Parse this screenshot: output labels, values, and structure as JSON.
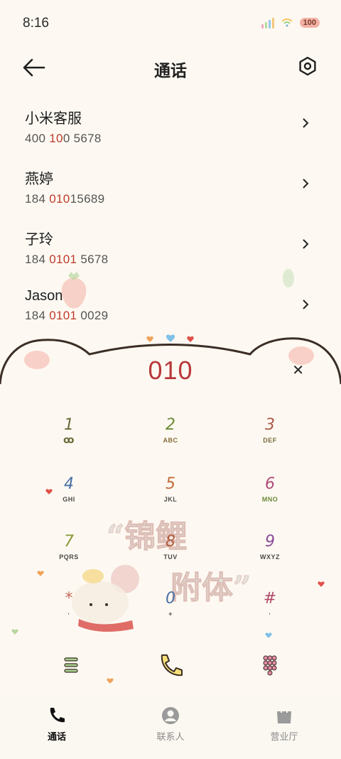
{
  "status_bar": {
    "time": "8:16",
    "battery": "100"
  },
  "header": {
    "title": "通话",
    "back_icon": "arrow-left-icon",
    "settings_icon": "settings-hexagon-icon"
  },
  "contacts": [
    {
      "name": "小米客服",
      "number_parts": [
        "400 ",
        "10",
        "0 5678"
      ]
    },
    {
      "name": "燕婷",
      "number_parts": [
        "184 ",
        "010",
        "15689"
      ]
    },
    {
      "name": "子玲",
      "number_parts": [
        "184 ",
        "0101",
        " 5678"
      ]
    },
    {
      "name": "Jason",
      "number_parts": [
        "184 ",
        "0101",
        " 0029"
      ]
    }
  ],
  "dialer": {
    "input": "010",
    "clear_icon": "close-icon"
  },
  "keypad": [
    {
      "digit": "1",
      "letters": "ꝏ",
      "color": "#6b6b3a"
    },
    {
      "digit": "2",
      "letters": "ABC",
      "color": "#6f8a3a"
    },
    {
      "digit": "3",
      "letters": "DEF",
      "color": "#b05a4a"
    },
    {
      "digit": "4",
      "letters": "GHI",
      "color": "#4a6fa5"
    },
    {
      "digit": "5",
      "letters": "JKL",
      "color": "#c46a3a"
    },
    {
      "digit": "6",
      "letters": "MNO",
      "color": "#b04a7a"
    },
    {
      "digit": "7",
      "letters": "PQRS",
      "color": "#8a9a3a"
    },
    {
      "digit": "8",
      "letters": "TUV",
      "color": "#b05a3a"
    },
    {
      "digit": "9",
      "letters": "WXYZ",
      "color": "#8a4a9a"
    },
    {
      "digit": "*",
      "letters": "·",
      "color": "#c46a5a"
    },
    {
      "digit": "0",
      "letters": "+",
      "color": "#4a6fa5"
    },
    {
      "digit": "#",
      "letters": "·",
      "color": "#b04a6a"
    }
  ],
  "watermark": {
    "line1": "“锦鲤",
    "line2": "附体”"
  },
  "actions": {
    "menu_icon": "menu-lines-icon",
    "call_icon": "phone-call-icon",
    "keypad_icon": "keypad-grid-icon"
  },
  "bottom_nav": [
    {
      "label": "通话",
      "icon": "phone-icon",
      "active": true
    },
    {
      "label": "联系人",
      "icon": "person-icon",
      "active": false
    },
    {
      "label": "营业厅",
      "icon": "shopping-bag-icon",
      "active": false
    }
  ],
  "colors": {
    "background": "#fdf9f2",
    "accent_red": "#b9373a",
    "highlight": "#c0392b"
  }
}
